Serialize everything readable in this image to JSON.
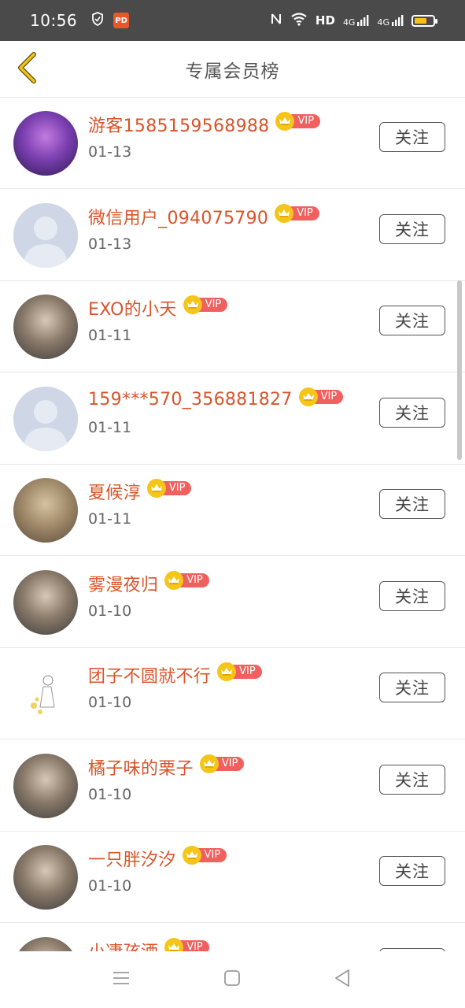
{
  "status_bar": {
    "time": "10:56",
    "app_badge": "PD",
    "hd_label": "HD",
    "signal_1": "4G",
    "signal_2": "4G",
    "battery_level": 0.7,
    "icons": [
      "shield-icon",
      "app-badge-icon",
      "nfc-icon",
      "wifi-icon",
      "signal-icon",
      "signal-icon",
      "battery-icon"
    ]
  },
  "header": {
    "title": "专属会员榜",
    "back_icon": "chevron-left-icon"
  },
  "vip_label": "VIP",
  "follow_label": "关注",
  "members": [
    {
      "name": "游客1585159568988",
      "date": "01-13",
      "avatar": "concert-photo"
    },
    {
      "name": "微信用户_094075790",
      "date": "01-13",
      "avatar": "default-avatar"
    },
    {
      "name": "EXO的小天",
      "date": "01-11",
      "avatar": "person-photo"
    },
    {
      "name": "159***570_356881827",
      "date": "01-11",
      "avatar": "default-avatar"
    },
    {
      "name": "夏候淳",
      "date": "01-11",
      "avatar": "cat-photo"
    },
    {
      "name": "雾漫夜归",
      "date": "01-10",
      "avatar": "person-photo"
    },
    {
      "name": "团子不圆就不行",
      "date": "01-10",
      "avatar": "sketch-photo"
    },
    {
      "name": "橘子味的栗子",
      "date": "01-10",
      "avatar": "person-photo"
    },
    {
      "name": "一只胖汐汐",
      "date": "01-10",
      "avatar": "person-photo"
    },
    {
      "name": "小凄孩洒",
      "date": "",
      "avatar": "person-photo"
    }
  ],
  "system_nav": {
    "icons": [
      "menu-icon",
      "home-square-icon",
      "back-triangle-icon"
    ]
  }
}
